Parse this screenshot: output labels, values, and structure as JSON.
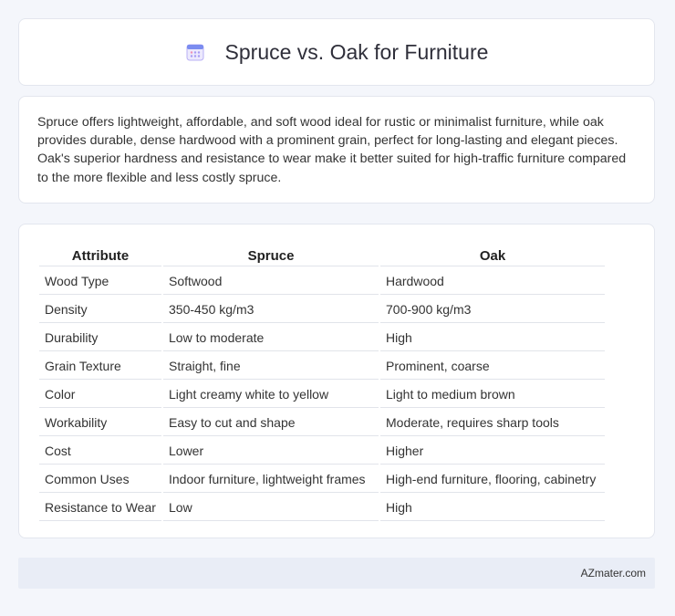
{
  "header": {
    "title": "Spruce vs. Oak for Furniture",
    "icon": "calendar-icon"
  },
  "intro": {
    "text": "Spruce offers lightweight, affordable, and soft wood ideal for rustic or minimalist furniture, while oak provides durable, dense hardwood with a prominent grain, perfect for long-lasting and elegant pieces. Oak's superior hardness and resistance to wear make it better suited for high-traffic furniture compared to the more flexible and less costly spruce."
  },
  "table": {
    "headers": [
      "Attribute",
      "Spruce",
      "Oak"
    ],
    "rows": [
      [
        "Wood Type",
        "Softwood",
        "Hardwood"
      ],
      [
        "Density",
        "350-450 kg/m3",
        "700-900 kg/m3"
      ],
      [
        "Durability",
        "Low to moderate",
        "High"
      ],
      [
        "Grain Texture",
        "Straight, fine",
        "Prominent, coarse"
      ],
      [
        "Color",
        "Light creamy white to yellow",
        "Light to medium brown"
      ],
      [
        "Workability",
        "Easy to cut and shape",
        "Moderate, requires sharp tools"
      ],
      [
        "Cost",
        "Lower",
        "Higher"
      ],
      [
        "Common Uses",
        "Indoor furniture, lightweight frames",
        "High-end furniture, flooring, cabinetry"
      ],
      [
        "Resistance to Wear",
        "Low",
        "High"
      ]
    ]
  },
  "footer": {
    "text": "AZmater.com"
  },
  "colors": {
    "background": "#f4f6fb",
    "footer_bg": "#e9edf6",
    "icon_accent": "#7b6cf0"
  }
}
